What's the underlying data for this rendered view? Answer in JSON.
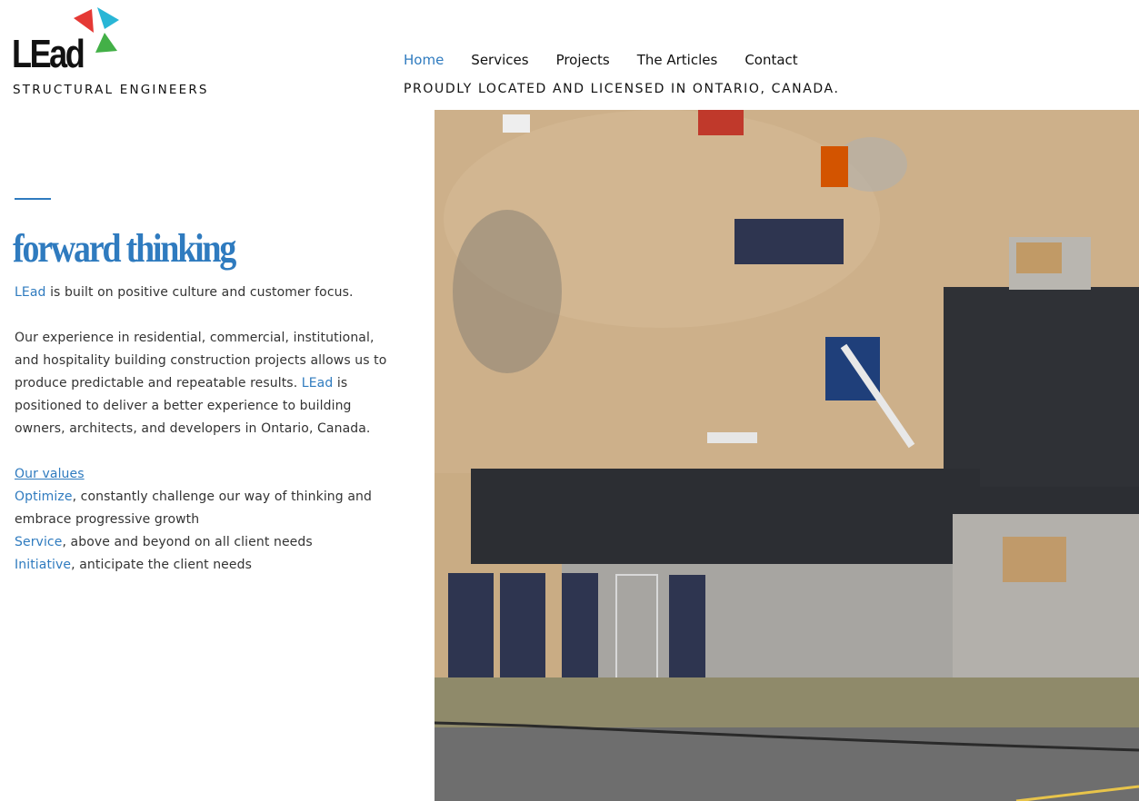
{
  "logo": {
    "wordmark": "LEad",
    "subtitle": "STRUCTURAL ENGINEERS",
    "colors": {
      "red": "#e53935",
      "cyan": "#29b6d6",
      "green": "#43b047"
    }
  },
  "nav": {
    "items": [
      {
        "label": "Home",
        "active": true
      },
      {
        "label": "Services",
        "active": false
      },
      {
        "label": "Projects",
        "active": false
      },
      {
        "label": "The Articles",
        "active": false
      },
      {
        "label": "Contact",
        "active": false
      }
    ]
  },
  "tagline": "PROUDLY LOCATED AND LICENSED IN ONTARIO, CANADA.",
  "hero": {
    "title": "forward thinking",
    "intro_brand": "LEad",
    "intro_rest": " is built on positive culture and customer focus.",
    "experience_text": "Our experience in residential, commercial, institutional, and hospitality building construction projects allows us to produce predictable and repeatable results. ",
    "experience_brand": "LEad",
    "experience_rest": " is positioned to deliver a better experience to building owners, architects, and developers in Ontario, Canada.",
    "values_link": "Our values",
    "values": [
      {
        "term": "Optimize",
        "text": ", constantly challenge our way of thinking and embrace progressive growth"
      },
      {
        "term": "Service",
        "text": ", above and beyond on all client needs"
      },
      {
        "term": "Initiative",
        "text": ", anticipate the client needs"
      }
    ]
  },
  "theme": {
    "accent": "#2f7bbf"
  },
  "photo": {
    "icon": "construction-site-aerial-image"
  }
}
